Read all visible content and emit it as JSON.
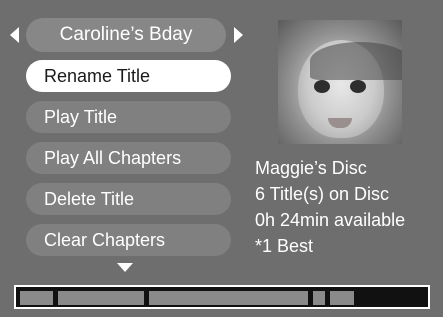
{
  "title_selector": {
    "label": "Caroline’s Bday",
    "prev_icon": "triangle-left-icon",
    "next_icon": "triangle-right-icon"
  },
  "menu": {
    "items": [
      {
        "label": "Rename Title",
        "selected": true
      },
      {
        "label": "Play Title",
        "selected": false
      },
      {
        "label": "Play All Chapters",
        "selected": false
      },
      {
        "label": "Delete Title",
        "selected": false
      },
      {
        "label": "Clear Chapters",
        "selected": false
      }
    ],
    "more_icon": "triangle-down-icon"
  },
  "disc_info": {
    "name": "Maggie’s Disc",
    "title_count": "6 Title(s) on Disc",
    "available": "0h 24min available",
    "quality": "*1 Best"
  },
  "usage": {
    "segments": [
      {
        "label": "title 1",
        "fraction": 0.08
      },
      {
        "label": "title 2",
        "fraction": 0.21
      },
      {
        "label": "title 3",
        "fraction": 0.39
      },
      {
        "label": "title 4",
        "fraction": 0.03
      },
      {
        "label": "title 5",
        "fraction": 0.06
      }
    ]
  },
  "colors": {
    "background": "#6e6e6e",
    "pill": "#808080",
    "selected_pill": "#ffffff",
    "text": "#ffffff",
    "bar_background": "#111111"
  }
}
